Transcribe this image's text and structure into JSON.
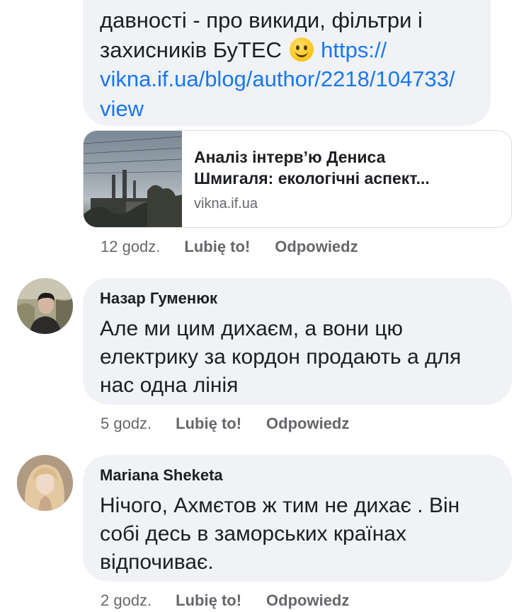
{
  "first_comment": {
    "lines": [
      "давності - про викиди, фільтри і",
      "захисників БуТЕС"
    ],
    "link_parts": [
      "https://",
      "vikna.if.ua/blog/author/2218/104733/",
      "view"
    ],
    "preview": {
      "title_line1": "Аналіз інтерв’ю Дениса",
      "title_line2": "Шмигаля: екологічні аспект...",
      "domain": "vikna.if.ua"
    },
    "time": "12 godz.",
    "like_label": "Lubię to!",
    "reply_label": "Odpowiedz"
  },
  "comments": [
    {
      "author": "Назар Гуменюк",
      "lines": [
        "Але ми цим дихаєм, а вони цю",
        "електрику за кордон продають а для",
        "нас одна лінія"
      ],
      "time": "5 godz.",
      "like_label": "Lubię to!",
      "reply_label": "Odpowiedz"
    },
    {
      "author": "Mariana Sheketa",
      "lines": [
        "Нічого, Ахмєтов ж тим не дихає . Він",
        "собі десь в заморських країнах",
        "відпочиває."
      ],
      "time": "2 godz.",
      "like_label": "Lubię to!",
      "reply_label": "Odpowiedz"
    }
  ],
  "colors": {
    "bubble": "#f0f2f5",
    "link": "#1877f2",
    "meta": "#65676b",
    "text": "#1c1e21"
  }
}
